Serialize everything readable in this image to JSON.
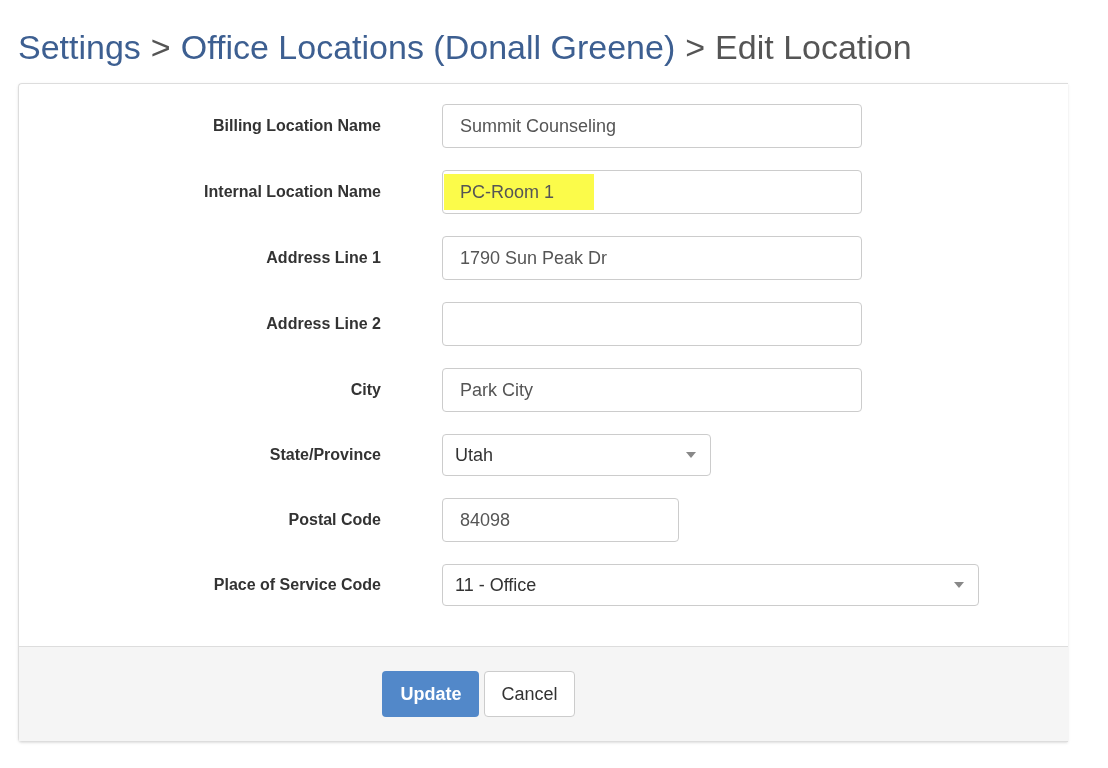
{
  "breadcrumb": [
    {
      "kind": "link",
      "text": "Settings"
    },
    {
      "kind": "separator",
      "text": ">"
    },
    {
      "kind": "link",
      "text": "Office Locations (Donall Greene)"
    },
    {
      "kind": "separator",
      "text": ">"
    },
    {
      "kind": "current",
      "text": "Edit Location"
    }
  ],
  "fields": [
    {
      "label": "Billing Location Name",
      "kind": "text",
      "value": "Summit Counseling",
      "highlighted": false
    },
    {
      "label": "Internal Location Name",
      "kind": "text",
      "value": "PC-Room 1",
      "highlighted": true
    },
    {
      "label": "Address Line 1",
      "kind": "text",
      "value": "1790 Sun Peak Dr",
      "highlighted": false
    },
    {
      "label": "Address Line 2",
      "kind": "text",
      "highlighted": false
    },
    {
      "label": "City",
      "kind": "text",
      "value": "Park City",
      "highlighted": false
    },
    {
      "label": "State/Province",
      "kind": "select",
      "value": "Utah",
      "highlighted": false
    },
    {
      "label": "Postal Code",
      "kind": "text",
      "value": "84098",
      "highlighted": false
    },
    {
      "label": "Place of Service Code",
      "kind": "select",
      "value": "11 - Office",
      "highlighted": false
    }
  ],
  "buttons": [
    {
      "kind": "primary",
      "label": "Update"
    },
    {
      "kind": "default",
      "label": "Cancel"
    }
  ]
}
